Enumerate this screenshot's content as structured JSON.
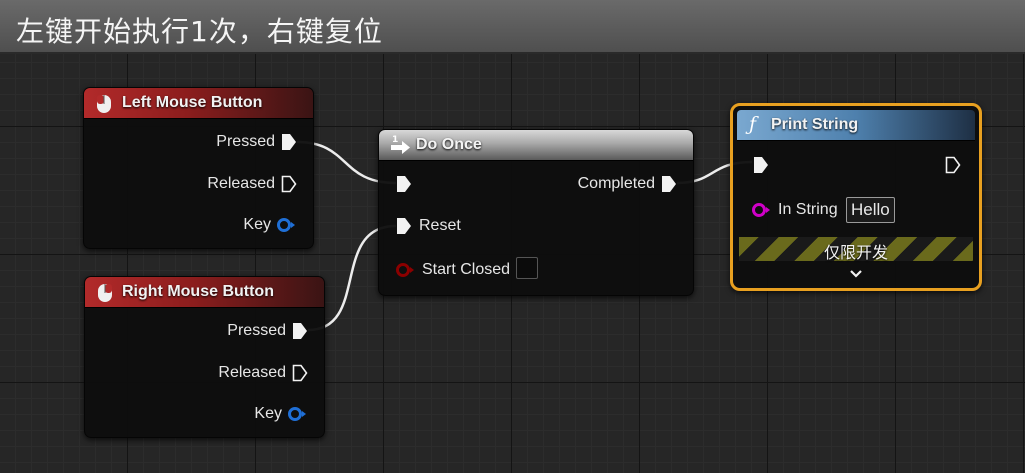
{
  "title": "左键开始执行1次，右键复位",
  "nodes": {
    "left_mouse": {
      "title": "Left Mouse Button",
      "pins": {
        "pressed": "Pressed",
        "released": "Released",
        "key": "Key"
      }
    },
    "right_mouse": {
      "title": "Right Mouse Button",
      "pins": {
        "pressed": "Pressed",
        "released": "Released",
        "key": "Key"
      }
    },
    "do_once": {
      "title": "Do Once",
      "pins": {
        "completed": "Completed",
        "reset": "Reset",
        "start_closed": "Start Closed"
      }
    },
    "print_string": {
      "title": "Print String",
      "pins": {
        "in_string": "In String"
      },
      "in_string_value": "Hello",
      "dev_only_label": "仅限开发"
    }
  },
  "colors": {
    "event_header": "#b22a2a",
    "function_header": "#4e80ad",
    "selection": "#e8a020",
    "key_pin": "#1f6fd6",
    "string_pin": "#d000c8",
    "bool_pin": "#8b0000"
  },
  "icons": {
    "event": "mouse-icon",
    "do_once": "do-once-icon",
    "function": "function-icon"
  }
}
